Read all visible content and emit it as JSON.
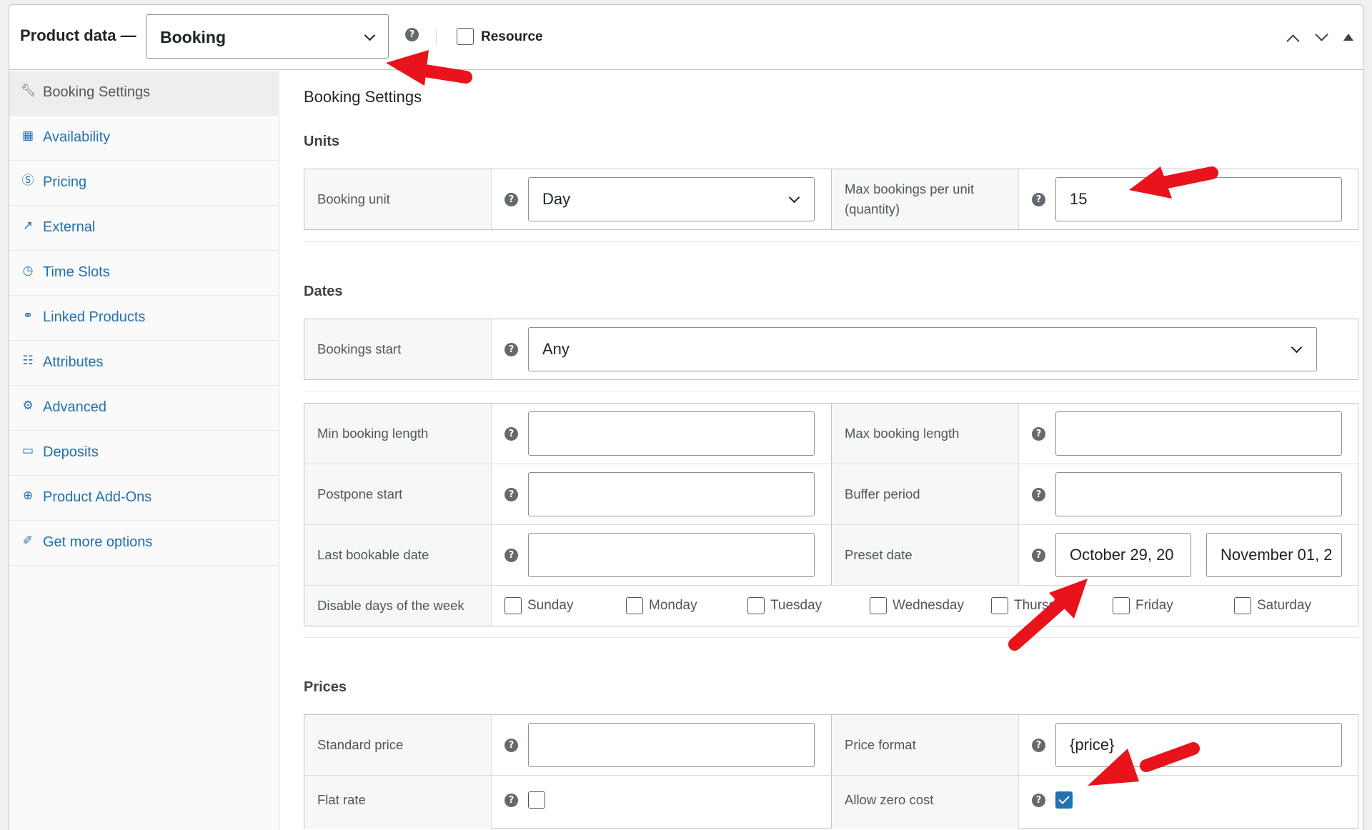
{
  "header": {
    "title": "Product data —",
    "product_type": "Booking",
    "resource_label": "Resource"
  },
  "sidebar": {
    "items": [
      {
        "label": "Booking Settings",
        "icon": "wrench-icon",
        "active": true
      },
      {
        "label": "Availability",
        "icon": "calendar-icon"
      },
      {
        "label": "Pricing",
        "icon": "dollar-icon"
      },
      {
        "label": "External",
        "icon": "external-link-icon"
      },
      {
        "label": "Time Slots",
        "icon": "clock-icon"
      },
      {
        "label": "Linked Products",
        "icon": "link-icon"
      },
      {
        "label": "Attributes",
        "icon": "list-icon"
      },
      {
        "label": "Advanced",
        "icon": "gear-icon"
      },
      {
        "label": "Deposits",
        "icon": "card-icon"
      },
      {
        "label": "Product Add-Ons",
        "icon": "plus-circle-icon"
      },
      {
        "label": "Get more options",
        "icon": "plugin-icon"
      }
    ]
  },
  "main": {
    "title": "Booking Settings",
    "units": {
      "heading": "Units",
      "booking_unit_label": "Booking unit",
      "booking_unit_value": "Day",
      "max_bookings_label_1": "Max bookings per unit",
      "max_bookings_label_2": "(quantity)",
      "max_bookings_value": "15"
    },
    "dates": {
      "heading": "Dates",
      "bookings_start_label": "Bookings start",
      "bookings_start_value": "Any",
      "min_length_label": "Min booking length",
      "max_length_label": "Max booking length",
      "postpone_label": "Postpone start",
      "buffer_label": "Buffer period",
      "last_date_label": "Last bookable date",
      "preset_label": "Preset date",
      "preset_from": "October 29, 20",
      "preset_to": "November 01, 2",
      "disable_days_label": "Disable days of the week",
      "days": [
        "Sunday",
        "Monday",
        "Tuesday",
        "Wednesday",
        "Thursd",
        "Friday",
        "Saturday"
      ]
    },
    "prices": {
      "heading": "Prices",
      "standard_label": "Standard price",
      "format_label": "Price format",
      "format_value": "{price}",
      "flat_rate_label": "Flat rate",
      "zero_cost_label": "Allow zero cost",
      "zero_cost_checked": true
    }
  },
  "colors": {
    "link": "#2271b1",
    "annotation": "#e8131b"
  }
}
